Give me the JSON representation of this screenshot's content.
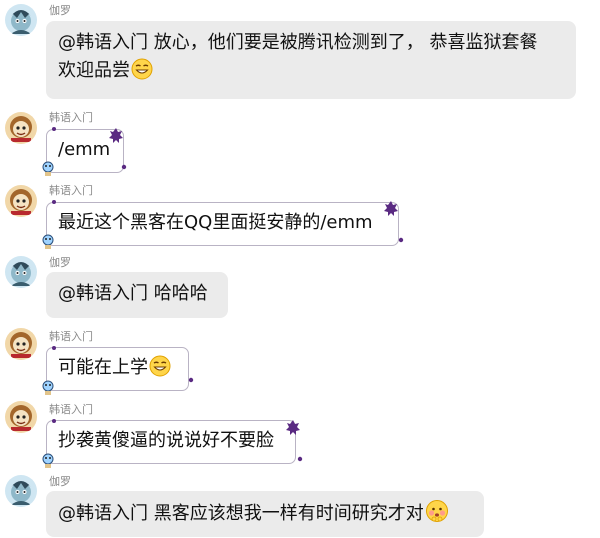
{
  "messages": [
    {
      "sender": "伽罗",
      "text": "@韩语入门 放心，他们要是被腾讯检测到了， 恭喜监狱套餐\n欢迎品尝",
      "emoji": "grin-emoji"
    },
    {
      "sender": "韩语入门",
      "text": "/emm",
      "emoji": ""
    },
    {
      "sender": "韩语入门",
      "text": "最近这个黑客在QQ里面挺安静的/emm",
      "emoji": ""
    },
    {
      "sender": "伽罗",
      "text": "@韩语入门 哈哈哈",
      "emoji": ""
    },
    {
      "sender": "韩语入门",
      "text": "可能在上学",
      "emoji": "grin-emoji"
    },
    {
      "sender": "韩语入门",
      "text": "抄袭黄傻逼的说说好不要脸",
      "emoji": ""
    },
    {
      "sender": "伽罗",
      "text": "@韩语入门 黑客应该想我一样有时间研究才对",
      "emoji": "shy-emoji"
    }
  ],
  "colors": {
    "grey_bubble": "#ebebeb",
    "fancy_border": "#b9b3c4",
    "sender_name": "#8a8a8a",
    "deco_purple": "#5a2a82"
  }
}
